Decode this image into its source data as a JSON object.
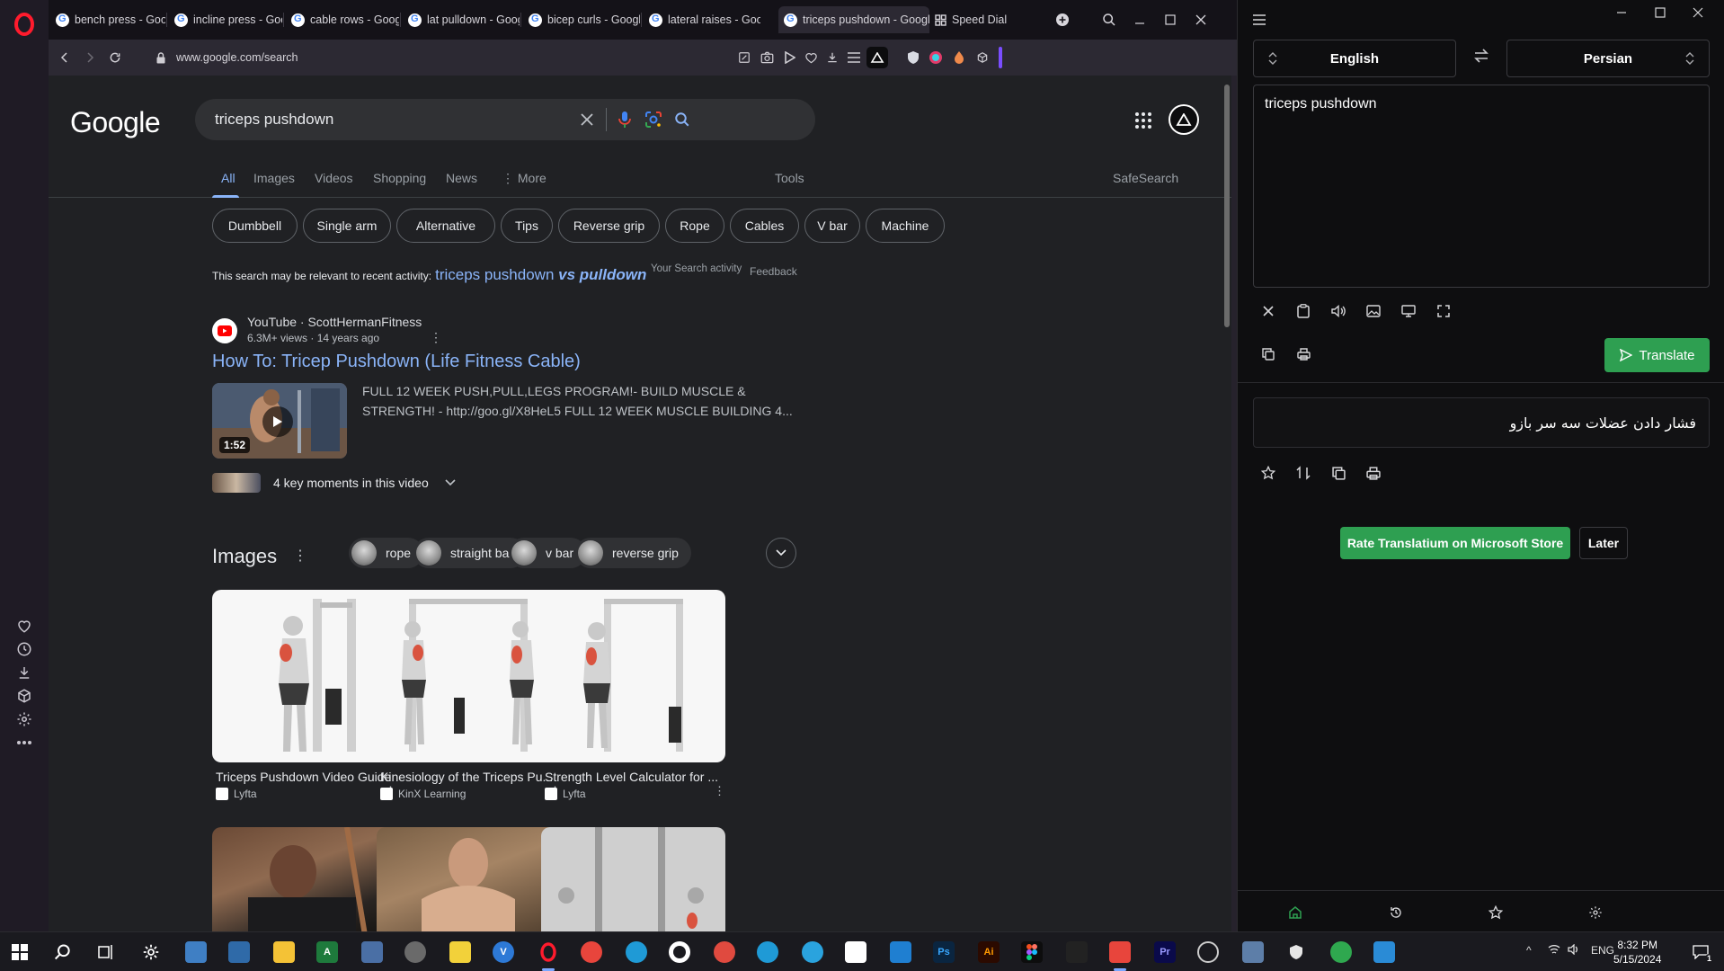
{
  "browser": {
    "tabs": [
      {
        "title": "bench press - Goog"
      },
      {
        "title": "incline press - Goog"
      },
      {
        "title": "cable rows - Google"
      },
      {
        "title": "lat pulldown - Goog"
      },
      {
        "title": "bicep curls - Google"
      },
      {
        "title": "lateral raises - Goog"
      },
      {
        "title": "triceps pushdown - Googl",
        "active": true
      },
      {
        "title": "Speed Dial"
      }
    ],
    "url": "www.google.com/search"
  },
  "google": {
    "logo": "Google",
    "query": "triceps pushdown",
    "tabs": [
      "All",
      "Images",
      "Videos",
      "Shopping",
      "News",
      "More"
    ],
    "tools": "Tools",
    "safesearch": "SafeSearch",
    "chips": [
      "Dumbbell",
      "Single arm",
      "Alternative",
      "Tips",
      "Reverse grip",
      "Rope",
      "Cables",
      "V bar",
      "Machine"
    ],
    "recent": {
      "prefix": "This search may be relevant to recent activity:",
      "link_plain": "triceps pushdown",
      "link_bold": "vs pulldown",
      "activity": "Your Search activity",
      "feedback": "Feedback"
    },
    "result": {
      "source": "YouTube · ScottHermanFitness",
      "meta": "6.3M+ views · 14 years ago",
      "title": "How To: Tricep Pushdown (Life Fitness Cable)",
      "snippet_1": "FULL 12 WEEK PUSH,PULL,LEGS PROGRAM!- BUILD MUSCLE &",
      "snippet_2": "STRENGTH! - http://goo.gl/X8HeL5 FULL 12 WEEK MUSCLE BUILDING 4...",
      "duration": "1:52",
      "key_moments": "4 key moments in this video"
    },
    "images": {
      "heading": "Images",
      "chips": [
        "rope",
        "straight bar",
        "v bar",
        "reverse grip"
      ],
      "cards": [
        {
          "title": "Triceps Pushdown Video Guide",
          "source": "Lyfta"
        },
        {
          "title": "Kinesiology of the Triceps Pu...",
          "source": "KinX Learning"
        },
        {
          "title": "Strength Level Calculator for ...",
          "source": "Lyfta"
        }
      ]
    }
  },
  "translatium": {
    "source_lang": "English",
    "target_lang": "Persian",
    "input": "triceps pushdown",
    "translate_label": "Translate",
    "output": "فشار دادن عضلات سه سر بازو",
    "rate_label": "Rate Translatium on Microsoft Store",
    "later_label": "Later",
    "accent": "#2e9f51"
  },
  "taskbar": {
    "lang": "ENG",
    "time": "8:32 PM",
    "date": "5/15/2024",
    "notification_count": "1"
  }
}
